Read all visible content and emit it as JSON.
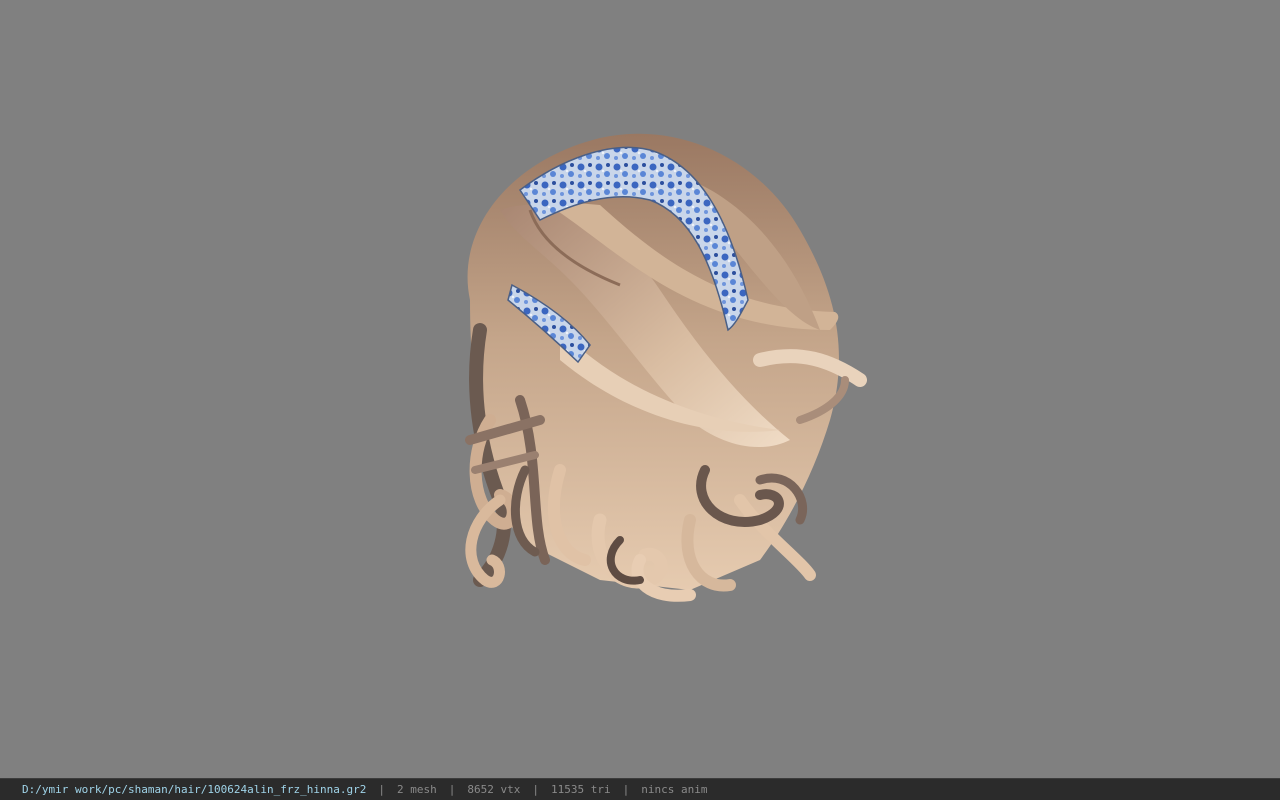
{
  "viewport": {
    "background": "#808080",
    "model_name": "hair mesh with blue floral headband"
  },
  "statusbar": {
    "file_path": "D:/ymir work/pc/shaman/hair/100624alin_frz_hinna.gr2",
    "separator": "|",
    "mesh_count": "2 mesh",
    "vertex_count": "8652 vtx",
    "triangle_count": "11535 tri",
    "anim_status": "nincs anim"
  },
  "colors": {
    "path_text": "#9fd3e8",
    "stat_text": "#8a8a8a",
    "statusbar_bg": "#2b2b2b",
    "hair_root": "#9c7a63",
    "hair_tip": "#e2c6aa",
    "headband_blue": "#3f6fbf"
  }
}
